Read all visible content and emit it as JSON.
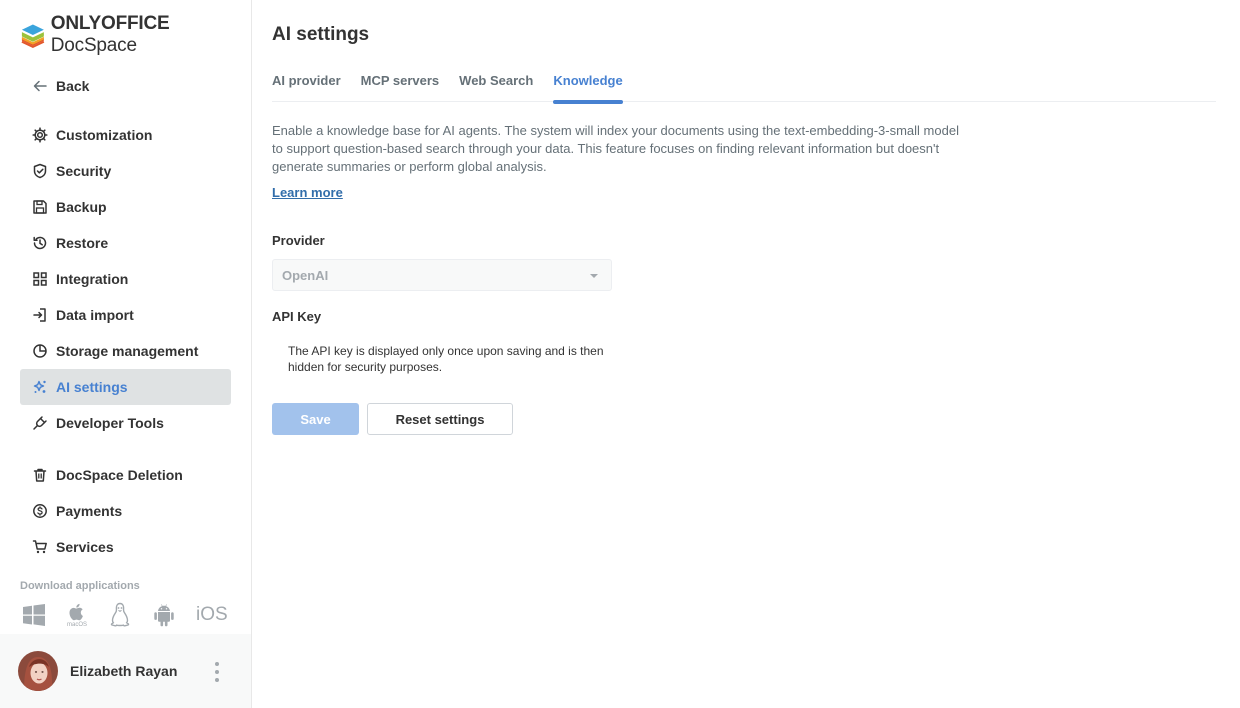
{
  "app": {
    "brand_bold": "ONLYOFFICE",
    "brand_regular": "DocSpace"
  },
  "sidebar": {
    "back_label": "Back",
    "items": [
      {
        "label": "Customization",
        "icon": "gear-icon"
      },
      {
        "label": "Security",
        "icon": "shield-icon"
      },
      {
        "label": "Backup",
        "icon": "floppy-icon"
      },
      {
        "label": "Restore",
        "icon": "history-icon"
      },
      {
        "label": "Integration",
        "icon": "grid-icon"
      },
      {
        "label": "Data import",
        "icon": "import-icon"
      },
      {
        "label": "Storage management",
        "icon": "pie-chart-icon"
      },
      {
        "label": "AI settings",
        "icon": "sparkle-icon",
        "active": true
      },
      {
        "label": "Developer Tools",
        "icon": "plug-icon"
      }
    ],
    "items2": [
      {
        "label": "DocSpace Deletion",
        "icon": "trash-icon"
      },
      {
        "label": "Payments",
        "icon": "dollar-icon"
      },
      {
        "label": "Services",
        "icon": "cart-icon"
      }
    ],
    "download_label": "Download applications",
    "apps": {
      "windows": "windows-icon",
      "macos": "apple-icon",
      "macos_caption": "macOS",
      "linux": "linux-icon",
      "android": "android-icon",
      "ios": "iOS"
    },
    "user_name": "Elizabeth Rayan"
  },
  "main": {
    "title": "AI settings",
    "tabs": [
      {
        "label": "AI provider"
      },
      {
        "label": "MCP servers"
      },
      {
        "label": "Web Search"
      },
      {
        "label": "Knowledge",
        "active": true
      }
    ],
    "description": "Enable a knowledge base for AI agents. The system will index your documents using the text-embedding-3-small model to support question-based search through your data. This feature focuses on finding relevant information but doesn't generate summaries or perform global analysis.",
    "learn_more": "Learn more",
    "provider_label": "Provider",
    "provider_value": "OpenAI",
    "api_key_label": "API Key",
    "api_key_note": "The API key is displayed only once upon saving and is then hidden for security purposes.",
    "save_label": "Save",
    "reset_label": "Reset settings"
  },
  "colors": {
    "accent": "#4781d1",
    "active_bg": "#dfe2e3",
    "save_disabled": "#a2c2ec",
    "link": "#316daa"
  }
}
